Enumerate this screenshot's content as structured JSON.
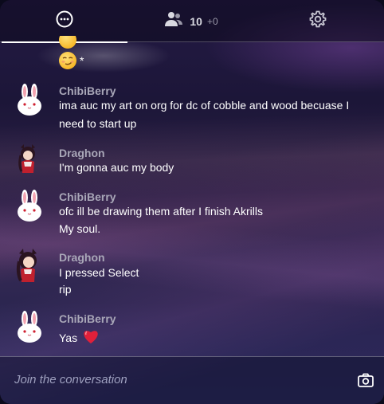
{
  "tabs": {
    "chat_icon": "chat-bubble-icon",
    "users_icon": "users-icon",
    "user_count": "10",
    "user_extra": "+0",
    "settings_icon": "gear-icon"
  },
  "messages": [
    {
      "author": "ChibiBerry",
      "avatar": "bunny-avatar",
      "lines": [
        "ima auc my art on org for dc of cobble and wood becuase I",
        "need to start up"
      ]
    },
    {
      "author": "Draghon",
      "avatar": "character-avatar",
      "lines": [
        "I'm gonna auc my body"
      ]
    },
    {
      "author": "ChibiBerry",
      "avatar": "bunny-avatar",
      "lines": [
        "ofc ill be drawing them after I finish Akrills",
        "My soul."
      ]
    },
    {
      "author": "Draghon",
      "avatar": "character-avatar",
      "lines": [
        "I pressed Select",
        "rip"
      ]
    },
    {
      "author": "ChibiBerry",
      "avatar": "bunny-avatar",
      "lines": [
        "Yas"
      ]
    }
  ],
  "top_partial": {
    "trailing_text": "*"
  },
  "composer": {
    "placeholder": "Join the conversation",
    "camera_icon": "camera-icon"
  },
  "colors": {
    "accent_underline": "#ffffff",
    "author": "#a9a7b8",
    "placeholder": "#9ea0bf",
    "heart": "#e0203a"
  }
}
